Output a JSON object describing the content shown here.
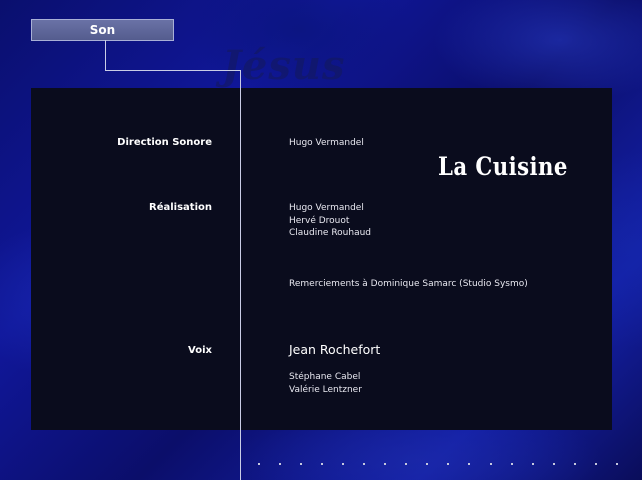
{
  "header": {
    "tab_label": "Son"
  },
  "background": {
    "watermark": "Jésus"
  },
  "logo": {
    "text": "La Cuisine"
  },
  "credits": {
    "direction_sonore": {
      "label": "Direction Sonore",
      "names": [
        "Hugo Vermandel"
      ]
    },
    "realisation": {
      "label": "Réalisation",
      "names": [
        "Hugo Vermandel",
        "Hervé Drouot",
        "Claudine Rouhaud"
      ]
    },
    "remerciements": "Remerciements à Dominique Samarc (Studio Sysmo)",
    "voix": {
      "label": "Voix",
      "lead": "Jean Rochefort",
      "names": [
        "Stéphane Cabel",
        "Valérie Lentzner"
      ]
    }
  },
  "footer": {
    "dot_count": 18
  },
  "colors": {
    "panel": "#0a0c1d",
    "tab": "#5c6496",
    "line": "#c9cde6",
    "text": "#ffffff"
  }
}
